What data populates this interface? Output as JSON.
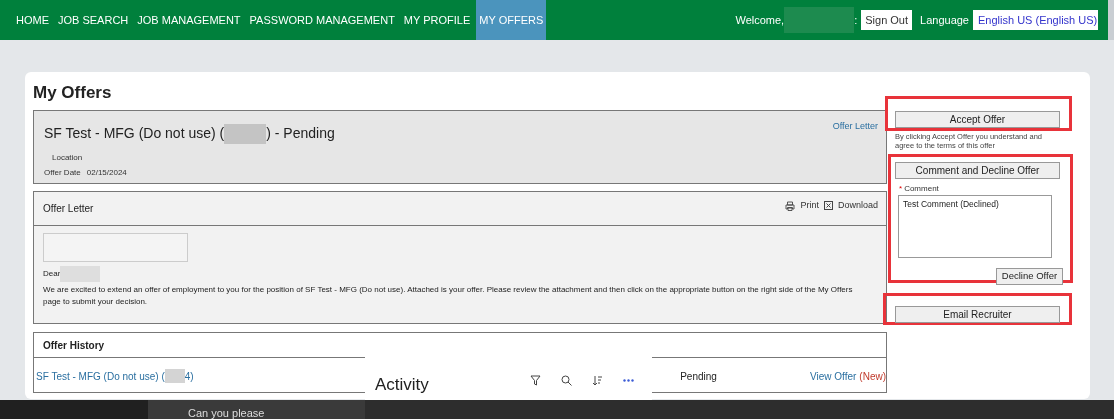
{
  "nav": {
    "items": [
      {
        "label": "HOME",
        "selected": false
      },
      {
        "label": "JOB SEARCH",
        "selected": false
      },
      {
        "label": "JOB MANAGEMENT",
        "selected": false
      },
      {
        "label": "PASSWORD MANAGEMENT",
        "selected": false
      },
      {
        "label": "MY PROFILE",
        "selected": false
      },
      {
        "label": "MY OFFERS",
        "selected": true
      }
    ],
    "welcome": "Welcome,",
    "welcome_suffix": ":",
    "sign_out": "Sign Out",
    "language_label": "Language",
    "language_value": "English US (English US)"
  },
  "page_title": "My Offers",
  "offer": {
    "title_start": "SF Test - MFG (Do not use) (",
    "title_end": ") - Pending",
    "offer_letter_link": "Offer Letter",
    "location_label": "Location",
    "date_label": "Offer Date",
    "date_value": "02/15/2024"
  },
  "letter": {
    "title": "Offer Letter",
    "print": "Print",
    "download": "Download",
    "greeting": "Dear",
    "body": "We are excited to extend an offer of employment to you for the position of SF Test - MFG (Do not use). Attached is your offer. Please review the attachment and then click on the appropriate button on the right side of the My Offers page to submit your decision."
  },
  "history": {
    "title": "Offer History",
    "rows": [
      {
        "position_start": "SF Test - MFG (Do not use) (",
        "position_end": "4)",
        "status": "Pending",
        "action": "View Offer",
        "tag": "(New)"
      }
    ]
  },
  "actions": {
    "accept": "Accept Offer",
    "accept_note": "By clicking Accept Offer you understand and agree to the terms of this offer",
    "comment_decline": "Comment and Decline Offer",
    "comment_label": "Comment",
    "required_mark": "*",
    "comment_value": "Test Comment (Declined)",
    "decline": "Decline Offer",
    "email": "Email Recruiter"
  },
  "activity_panel": {
    "title": "Activity"
  },
  "chat": {
    "message": "Can you please"
  }
}
